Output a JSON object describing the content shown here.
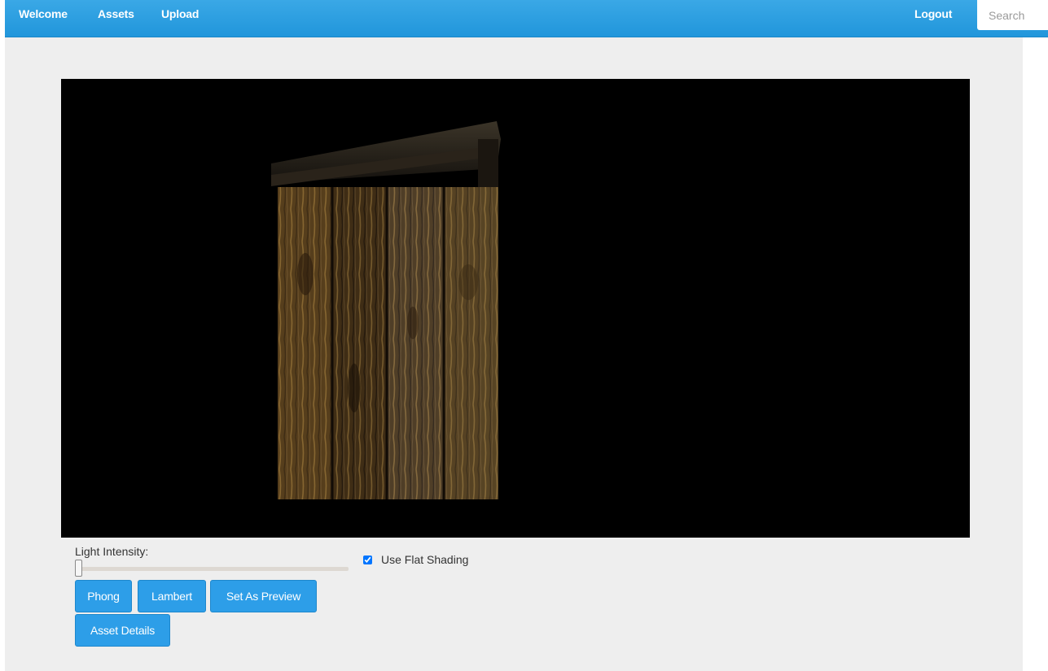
{
  "nav": {
    "welcome": "Welcome",
    "assets": "Assets",
    "upload": "Upload",
    "logout": "Logout",
    "search_placeholder": "Search"
  },
  "viewer": {
    "content": "3D model render of a wooden outhouse on black background"
  },
  "controls": {
    "light_intensity_label": "Light Intensity:",
    "light_intensity_value": 0,
    "flat_shading_label": "Use Flat Shading",
    "flat_shading_checked": true
  },
  "buttons": {
    "phong": "Phong",
    "lambert": "Lambert",
    "set_preview": "Set As Preview",
    "asset_details": "Asset Details"
  },
  "colors": {
    "nav_bg": "#2196db",
    "button_bg": "#2d9ee8",
    "panel_bg": "#eeeeee"
  }
}
